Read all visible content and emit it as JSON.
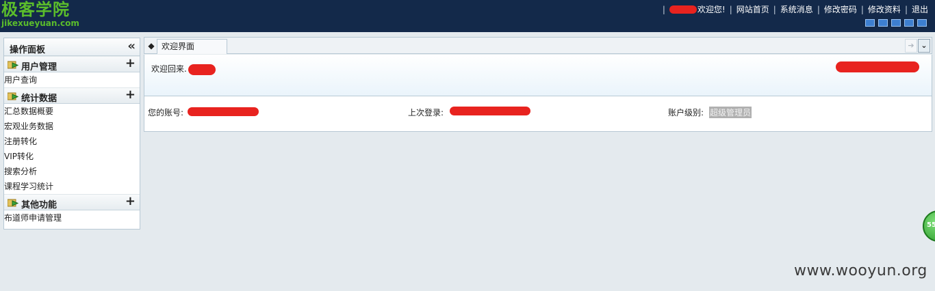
{
  "logo": {
    "cn": "极客学院",
    "en": "jikexueyuan.com"
  },
  "topnav": {
    "welcome": "欢迎您!",
    "links": [
      "网站首页",
      "系统消息",
      "修改密码",
      "修改资料",
      "退出"
    ]
  },
  "sidebar": {
    "title": "操作面板",
    "groups": [
      {
        "label": "用户管理",
        "items": [
          "用户查询"
        ]
      },
      {
        "label": "统计数据",
        "items": [
          "汇总数据概要",
          "宏观业务数据",
          "注册转化",
          "VIP转化",
          "搜索分析",
          "课程学习统计"
        ]
      },
      {
        "label": "其他功能",
        "items": [
          "布道师申请管理"
        ]
      }
    ]
  },
  "tabs": {
    "active": "欢迎界面"
  },
  "content": {
    "welcome": "欢迎回来.",
    "account_label": "您的账号:",
    "last_login_label": "上次登录:",
    "level_label": "账户级别:",
    "level_value": "超级管理员"
  },
  "float_widget": "55",
  "watermark": "www.wooyun.org",
  "colors": {
    "header_bg": "#13294a",
    "logo_green": "#5bbd2b",
    "redaction": "#e8231f"
  }
}
